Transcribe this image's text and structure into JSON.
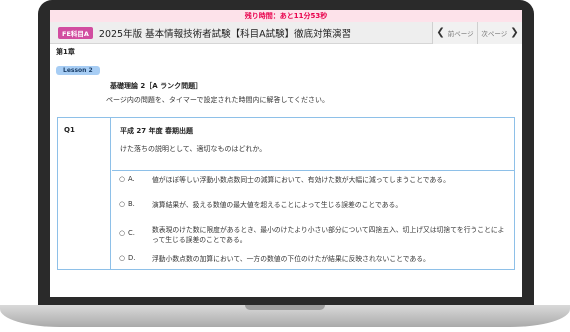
{
  "timer": {
    "text": "残り時間：あと11分53秒"
  },
  "header": {
    "badge": "FE科目A",
    "title": "2025年版 基本情報技術者試験【科目A試験】徹底対策演習",
    "prev_label": "前ページ",
    "next_label": "次ページ"
  },
  "chapter": "第1章",
  "lesson": "Lesson 2",
  "section_title": "基礎理論 2［A ランク問題］",
  "instructions": "ページ内の問題を、タイマーで設定された時間内に解答してください。",
  "question": {
    "number": "Q1",
    "year": "平成 27 年度 春期出題",
    "text": "けた落ちの説明として、適切なものはどれか。",
    "choices": [
      {
        "radio": "○",
        "letter": "A.",
        "text": "値がほぼ等しい浮動小数点数同士の減算において、有効けた数が大幅に減ってしまうことである。"
      },
      {
        "radio": "○",
        "letter": "B.",
        "text": "演算結果が、扱える数値の最大値を超えることによって生じる誤差のことである。"
      },
      {
        "radio": "○",
        "letter": "C.",
        "text": "数表現のけた数に限度があるとき、最小のけたより小さい部分について四捨五入、切上げ又は切捨てを行うことによって生じる誤差のことである。"
      },
      {
        "radio": "○",
        "letter": "D.",
        "text": "浮動小数点数の加算において、一方の数値の下位のけたが結果に反映されないことである。"
      }
    ]
  }
}
